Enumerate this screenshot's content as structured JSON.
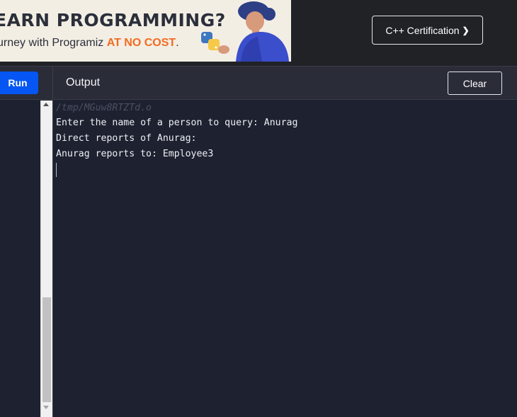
{
  "banner": {
    "title": "EARN PROGRAMMING?",
    "subtitle_prefix": "urney with Programiz ",
    "subtitle_accent": "AT NO COST",
    "subtitle_suffix": ".",
    "accent_color": "#f26b21"
  },
  "header": {
    "cert_button_label": "C++ Certification",
    "cert_button_chevron": "❯"
  },
  "toolbar": {
    "run_label": "Run",
    "output_label": "Output",
    "clear_label": "Clear",
    "run_color": "#0556f3"
  },
  "editor": {
    "visible_fragment": "<<"
  },
  "console": {
    "file_path": "/tmp/MGuw8RTZTd.o",
    "lines": [
      "Enter the name of a person to query: Anurag",
      "Direct reports of Anurag:",
      "Anurag reports to: Employee3"
    ]
  },
  "icons": {
    "scroll_up": "scroll-up-icon",
    "scroll_down": "scroll-down-icon",
    "python_logo": "python-logo-icon"
  }
}
